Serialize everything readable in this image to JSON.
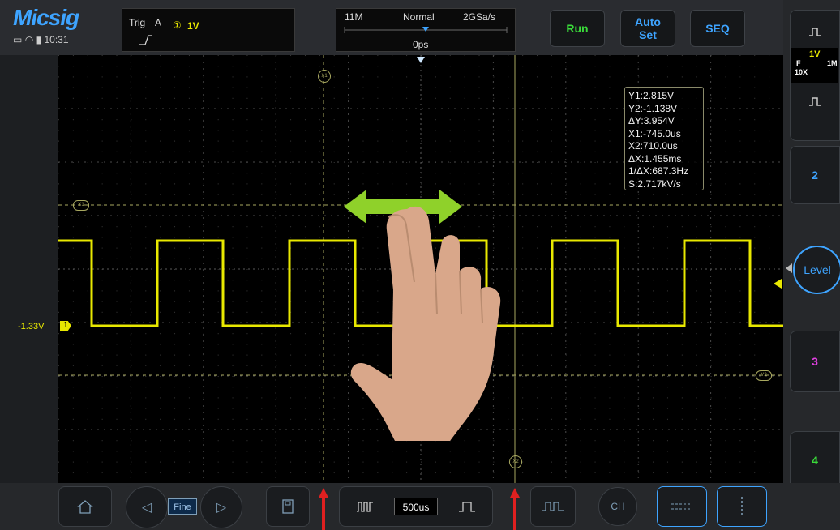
{
  "header": {
    "brand": "Micsig",
    "time": "10:31",
    "trigger": {
      "label": "Trig",
      "source": "A",
      "level_icon_text": "①",
      "level": "1V"
    },
    "timebase": {
      "memory": "11M",
      "mode": "Normal",
      "sample_rate": "2GSa/s",
      "offset": "0ps"
    },
    "buttons": {
      "run": "Run",
      "auto_set": "Auto Set",
      "seq": "SEQ"
    }
  },
  "channel1": {
    "offset_label": "-1.33V",
    "marker": "1",
    "color": "#e8e800"
  },
  "cursors": {
    "x1_marker": "X1",
    "x2_marker": "X2",
    "y1_marker": "Y1",
    "y2_marker": "Y2"
  },
  "measurements": [
    "Y1:2.815V",
    "Y2:-1.138V",
    "ΔY:3.954V",
    "X1:-745.0us",
    "X2:710.0us",
    "ΔX:1.455ms",
    "1/ΔX:687.3Hz",
    "S:2.717kV/s"
  ],
  "right_panel": {
    "ch1": {
      "scale": "1V",
      "coupling": "F",
      "probe": "10X",
      "impedance": "1M"
    },
    "ch2_label": "2",
    "level_label": "Level",
    "ch3_label": "3",
    "ch4_label": "4"
  },
  "bottom_bar": {
    "fine_label": "Fine",
    "timebase_scale": "500us",
    "ch_label": "CH"
  },
  "colors": {
    "ch1": "#e8e800",
    "ch2": "#3ea4ff",
    "ch3": "#e040e0",
    "ch4": "#3adb3a",
    "run": "#3adb3a",
    "brand": "#3ea4ff",
    "gesture_arrow": "#8fd12a"
  }
}
